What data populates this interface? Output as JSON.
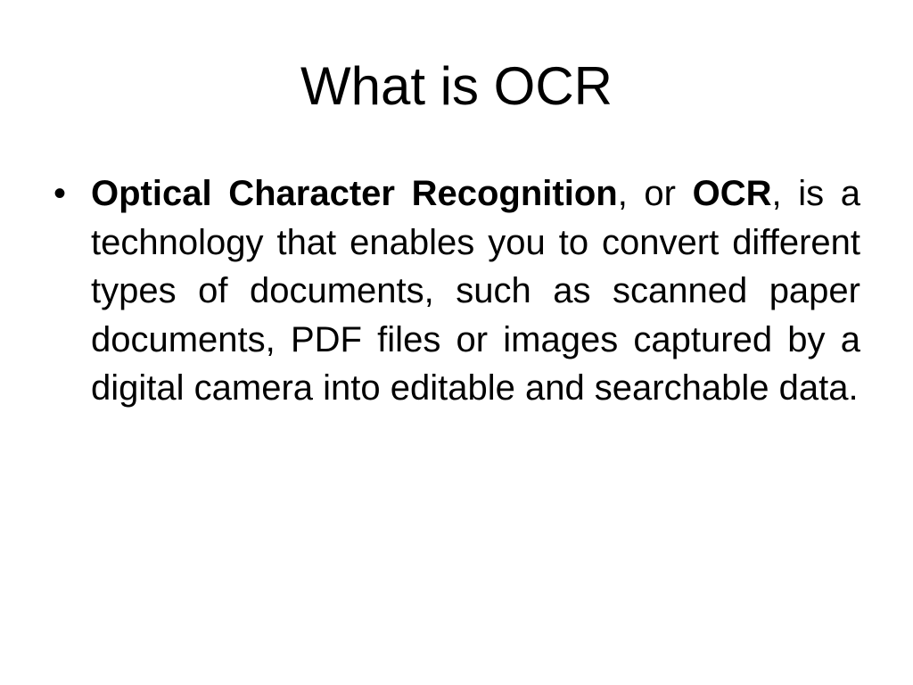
{
  "slide": {
    "title": "What is OCR",
    "bullets": [
      {
        "marker": "•",
        "term_full": "Optical Character Recognition",
        "connector": ", or ",
        "term_abbr": "OCR",
        "body": ", is a technology that enables you to convert different types of documents, such as scanned paper documents, PDF files or images captured by a digital camera into editable and searchable data."
      }
    ]
  }
}
